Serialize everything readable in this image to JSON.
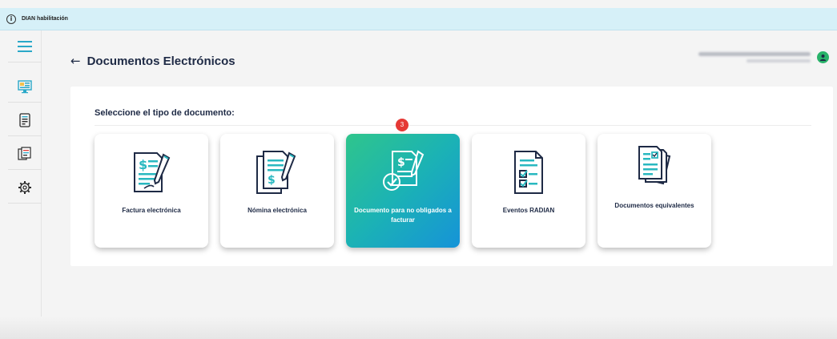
{
  "banner": {
    "text": "DIAN habilitación",
    "info_glyph": "i"
  },
  "header": {
    "back_glyph": "←",
    "title": "Documentos Electrónicos"
  },
  "sidebar": {
    "items": [
      {
        "icon": "menu-icon"
      },
      {
        "icon": "dashboard-monitor-icon"
      },
      {
        "icon": "document-list-icon"
      },
      {
        "icon": "documents-stack-icon"
      },
      {
        "icon": "gear-icon"
      }
    ]
  },
  "panel": {
    "heading": "Seleccione el tipo de documento:",
    "badge": "3",
    "cards": [
      {
        "label": "Factura electrónica",
        "icon": "invoice-icon",
        "active": false
      },
      {
        "label": "Nómina electrónica",
        "icon": "payroll-icon",
        "active": false
      },
      {
        "label": "Documento para no obligados a facturar",
        "icon": "support-document-icon",
        "active": true
      },
      {
        "label": "Eventos RADIAN",
        "icon": "events-checklist-icon",
        "active": false
      },
      {
        "label": "Documentos equivalentes",
        "icon": "equivalent-documents-icon",
        "active": false
      }
    ]
  },
  "colors": {
    "accent": "#29b8c0",
    "title": "#1e2a45",
    "badge": "#e53935",
    "avatar": "#29b36a",
    "banner": "#d6f0f8"
  }
}
